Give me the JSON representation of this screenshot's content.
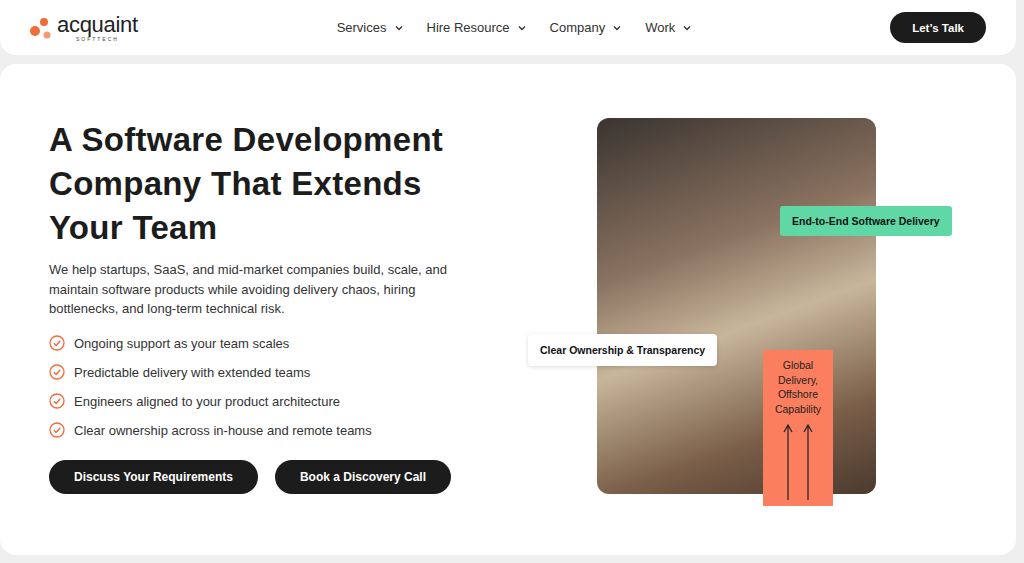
{
  "header": {
    "logo": {
      "name": "acquaint",
      "tagline": "SOFTTECH"
    },
    "nav": [
      {
        "label": "Services",
        "has_menu": true
      },
      {
        "label": "Hire Resource",
        "has_menu": true
      },
      {
        "label": "Company",
        "has_menu": true
      },
      {
        "label": "Work",
        "has_menu": true
      }
    ],
    "cta": "Let’s Talk"
  },
  "hero": {
    "title_lines": [
      "A Software Development",
      "Company That Extends",
      "Your Team"
    ],
    "description": "We help startups, SaaS, and mid-market companies build, scale, and maintain software products while avoiding delivery chaos, hiring bottlenecks, and long-term technical risk.",
    "checklist": [
      "Ongoing support as your team scales",
      "Predictable delivery with extended teams",
      "Engineers aligned to your product architecture",
      "Clear ownership across in-house and remote teams"
    ],
    "buttons": [
      "Discuss Your Requirements",
      "Book a Discovery Call"
    ],
    "badges": [
      {
        "text": "End-to-End Software Delivery",
        "kind": "highlight",
        "color": "#5fd8a6"
      },
      {
        "text": "Clear Ownership & Transparency",
        "kind": "plain",
        "color": "#ffffff"
      },
      {
        "text": "Global Delivery, Offshore Capability",
        "kind": "panel",
        "color": "#fb7f5f"
      }
    ]
  }
}
